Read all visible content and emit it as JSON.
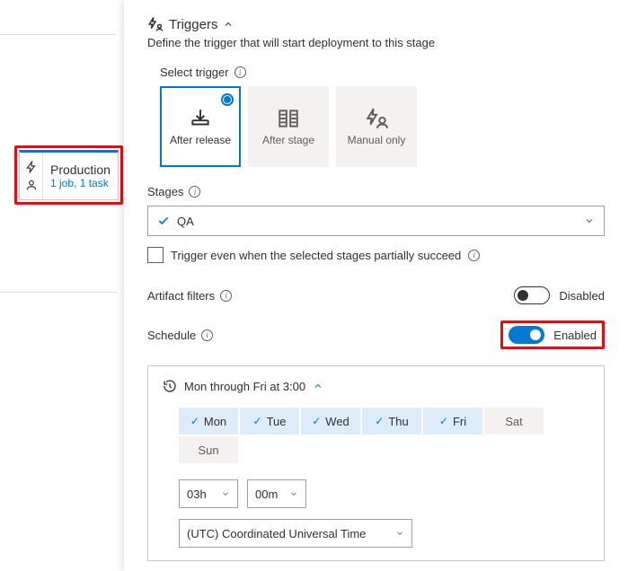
{
  "stage_card": {
    "title": "Production",
    "subtitle": "1 job, 1 task"
  },
  "panel": {
    "title": "Triggers",
    "description": "Define the trigger that will start deployment to this stage"
  },
  "select_trigger": {
    "label": "Select trigger",
    "options": {
      "after_release": "After release",
      "after_stage": "After stage",
      "manual_only": "Manual only"
    }
  },
  "stages": {
    "label": "Stages",
    "selected": "QA",
    "partial_label": "Trigger even when the selected stages partially succeed"
  },
  "artifact_filters": {
    "label": "Artifact filters",
    "state_label": "Disabled"
  },
  "schedule": {
    "label": "Schedule",
    "state_label": "Enabled",
    "summary": "Mon through Fri at 3:00",
    "days": {
      "mon": "Mon",
      "tue": "Tue",
      "wed": "Wed",
      "thu": "Thu",
      "fri": "Fri",
      "sat": "Sat",
      "sun": "Sun"
    },
    "hour": "03h",
    "minute": "00m",
    "timezone": "(UTC) Coordinated Universal Time"
  }
}
